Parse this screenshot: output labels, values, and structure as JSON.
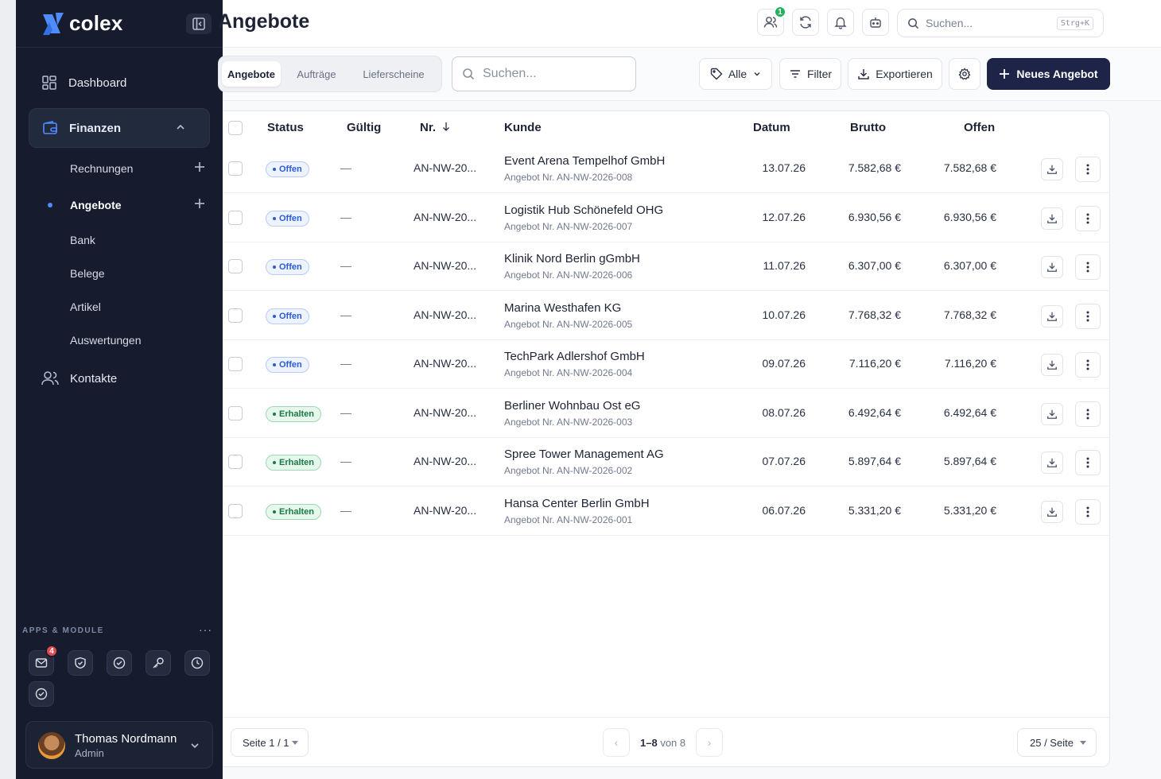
{
  "brand": {
    "name": "colex",
    "logo_color": "#4f8cff"
  },
  "sidebar": {
    "nav": [
      {
        "label": "Dashboard",
        "icon": "grid-icon"
      },
      {
        "label": "Finanzen",
        "icon": "wallet-icon"
      },
      {
        "label": "Kontakte",
        "icon": "users-icon"
      }
    ],
    "sub_items": [
      {
        "label": "Rechnungen",
        "has_add": true
      },
      {
        "label": "Angebote",
        "has_add": true,
        "active": true
      },
      {
        "label": "Bank"
      },
      {
        "label": "Belege"
      },
      {
        "label": "Artikel"
      },
      {
        "label": "Auswertungen"
      }
    ],
    "apps_label": "APPS & MODULE",
    "apps_more": "···",
    "apps": [
      {
        "icon": "mail-icon",
        "badge": "4"
      },
      {
        "icon": "shield-check-icon"
      },
      {
        "icon": "check-circle-icon"
      },
      {
        "icon": "key-icon"
      },
      {
        "icon": "clock-icon"
      },
      {
        "icon": "check-circle-icon"
      }
    ],
    "user": {
      "name": "Thomas Nordmann",
      "role": "Admin"
    }
  },
  "header": {
    "title": "Angebote",
    "users_badge": "1",
    "search_placeholder": "Suchen...",
    "search_shortcut": "Strg+K"
  },
  "toolbar": {
    "tabs": [
      "Angebote",
      "Aufträge",
      "Lieferscheine"
    ],
    "active_tab": "Angebote",
    "search_placeholder": "Suchen...",
    "tag_filter": "Alle",
    "filter_label": "Filter",
    "export_label": "Exportieren",
    "new_label": "Neues Angebot"
  },
  "table": {
    "columns": [
      "Status",
      "Gültig",
      "Nr.",
      "Kunde",
      "Datum",
      "Brutto",
      "Offen"
    ],
    "rows": [
      {
        "status": "Offen",
        "valid": "—",
        "nr": "AN-NW-20...",
        "customer": "Event Arena Tempelhof GmbH",
        "sub": "Angebot Nr. AN-NW-2026-008",
        "date": "13.07.26",
        "gross": "7.582,68 €",
        "open": "7.582,68 €"
      },
      {
        "status": "Offen",
        "valid": "—",
        "nr": "AN-NW-20...",
        "customer": "Logistik Hub Schönefeld OHG",
        "sub": "Angebot Nr. AN-NW-2026-007",
        "date": "12.07.26",
        "gross": "6.930,56 €",
        "open": "6.930,56 €"
      },
      {
        "status": "Offen",
        "valid": "—",
        "nr": "AN-NW-20...",
        "customer": "Klinik Nord Berlin gGmbH",
        "sub": "Angebot Nr. AN-NW-2026-006",
        "date": "11.07.26",
        "gross": "6.307,00 €",
        "open": "6.307,00 €"
      },
      {
        "status": "Offen",
        "valid": "—",
        "nr": "AN-NW-20...",
        "customer": "Marina Westhafen KG",
        "sub": "Angebot Nr. AN-NW-2026-005",
        "date": "10.07.26",
        "gross": "7.768,32 €",
        "open": "7.768,32 €"
      },
      {
        "status": "Offen",
        "valid": "—",
        "nr": "AN-NW-20...",
        "customer": "TechPark Adlershof GmbH",
        "sub": "Angebot Nr. AN-NW-2026-004",
        "date": "09.07.26",
        "gross": "7.116,20 €",
        "open": "7.116,20 €"
      },
      {
        "status": "Erhalten",
        "valid": "—",
        "nr": "AN-NW-20...",
        "customer": "Berliner Wohnbau Ost eG",
        "sub": "Angebot Nr. AN-NW-2026-003",
        "date": "08.07.26",
        "gross": "6.492,64 €",
        "open": "6.492,64 €"
      },
      {
        "status": "Erhalten",
        "valid": "—",
        "nr": "AN-NW-20...",
        "customer": "Spree Tower Management AG",
        "sub": "Angebot Nr. AN-NW-2026-002",
        "date": "07.07.26",
        "gross": "5.897,64 €",
        "open": "5.897,64 €"
      },
      {
        "status": "Erhalten",
        "valid": "—",
        "nr": "AN-NW-20...",
        "customer": "Hansa Center Berlin GmbH",
        "sub": "Angebot Nr. AN-NW-2026-001",
        "date": "06.07.26",
        "gross": "5.331,20 €",
        "open": "5.331,20 €"
      }
    ]
  },
  "footer": {
    "page_label": "Seite 1 / 1",
    "range": "1–8",
    "of_label": "von 8",
    "per_page": "25 / Seite",
    "prev": "‹",
    "next": "›"
  }
}
